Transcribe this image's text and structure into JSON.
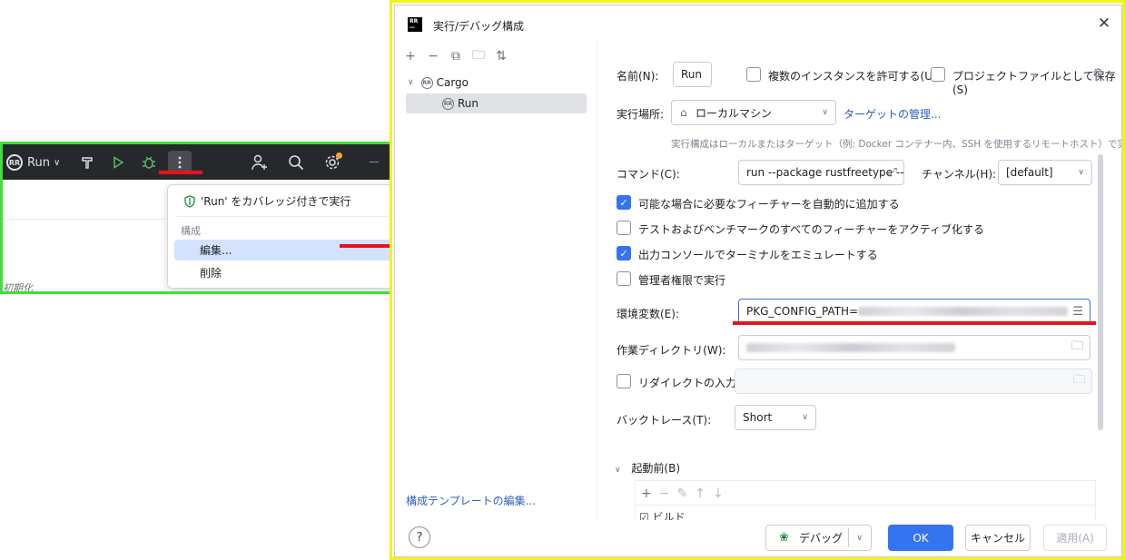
{
  "ide": {
    "run_config_label": "Run",
    "run_config_icon": "rust-rr-icon",
    "toolbar_icons": [
      "hammer-icon",
      "run-triangle-icon",
      "debug-bug-icon",
      "more-vertical-icon",
      "add-user-icon",
      "search-icon",
      "settings-gear-icon",
      "minimize-icon"
    ],
    "context_menu": {
      "run_with_coverage": "'Run' をカバレッジ付きで実行",
      "section_label": "構成",
      "edit_label": "編集...",
      "delete_label": "削除"
    },
    "faded_text": "初期化",
    "highlight_color": "#e8131b"
  },
  "dialog": {
    "title": "実行/デバッグ構成",
    "tree": {
      "group_label": "Cargo",
      "selected_item": "Run"
    },
    "edit_templates_link": "構成テンプレートの編集...",
    "form": {
      "name_label": "名前(N):",
      "name_value": "Run",
      "allow_multiple_label": "複数のインスタンスを許可する(U)",
      "allow_multiple_checked": false,
      "store_as_project_file_label": "プロジェクトファイルとして保存(S)",
      "store_as_project_file_checked": false,
      "run_on_label": "実行場所:",
      "run_on_value": "ローカルマシン",
      "manage_targets_link": "ターゲットの管理...",
      "run_on_hint": "実行構成はローカルまたはターゲット（例: Docker コンテナー内、SSH を使用するリモートホスト）で実行できます。",
      "command_label": "コマンド(C):",
      "command_value": "run --package rustfreetype --",
      "channel_label": "チャンネル(H):",
      "channel_value": "[default]",
      "options": [
        {
          "label": "可能な場合に必要なフィーチャーを自動的に追加する",
          "checked": true
        },
        {
          "label": "テストおよびベンチマークのすべてのフィーチャーをアクティブ化する",
          "checked": false
        },
        {
          "label": "出力コンソールでターミナルをエミュレートする",
          "checked": true
        },
        {
          "label": "管理者権限で実行",
          "checked": false
        }
      ],
      "env_label": "環境変数(E):",
      "env_value": "PKG_CONFIG_PATH=",
      "workdir_label": "作業ディレクトリ(W):",
      "redirect_input_label": "リダイレクトの入力元:",
      "redirect_input_checked": false,
      "backtrace_label": "バックトレース(T):",
      "backtrace_value": "Short",
      "before_launch_label": "起動前(B)",
      "before_launch_item": "ビルド"
    },
    "footer": {
      "debug_label": "デバッグ",
      "ok_label": "OK",
      "cancel_label": "キャンセル",
      "apply_label": "適用(A)",
      "help_label": "?"
    },
    "accent_color": "#3574f0"
  }
}
